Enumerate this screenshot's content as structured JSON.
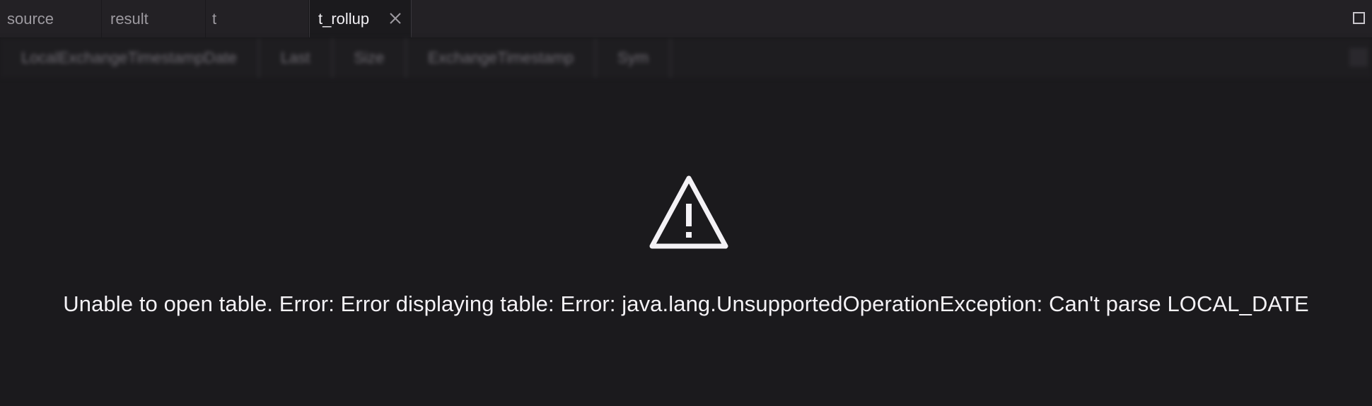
{
  "tabs": [
    {
      "label": "source",
      "active": false
    },
    {
      "label": "result",
      "active": false
    },
    {
      "label": "t",
      "active": false
    },
    {
      "label": "t_rollup",
      "active": true
    }
  ],
  "active_tab_close_icon": "close-icon",
  "maximize_icon": "maximize-icon",
  "columns": [
    "LocalExchangeTimestampDate",
    "Last",
    "Size",
    "ExchangeTimestamp",
    "Sym"
  ],
  "error": {
    "icon": "warning-icon",
    "message": "Unable to open table. Error: Error displaying table: Error: java.lang.UnsupportedOperationException: Can't parse LOCAL_DATE"
  },
  "colors": {
    "background": "#1b1a1d",
    "tabbar": "#232125",
    "active_tab_text": "#f1eff3",
    "inactive_tab_text": "#9d9aa0",
    "error_text": "#f4f2f6"
  }
}
